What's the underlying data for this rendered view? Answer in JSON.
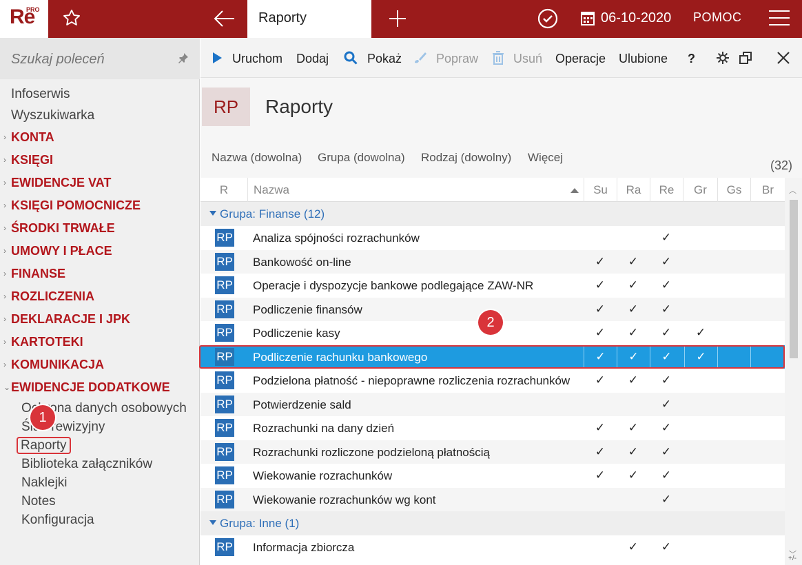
{
  "topbar": {
    "logo_text": "Re",
    "logo_badge": "PRO",
    "active_tab": "Raporty",
    "date": "06-10-2020",
    "help": "POMOC",
    "icons": [
      "star-icon",
      "back-arrow-icon",
      "plus-icon",
      "check-circle-icon",
      "calendar-icon",
      "hamburger-menu-icon"
    ]
  },
  "sidebar": {
    "search_placeholder": "Szukaj poleceń",
    "plain_items": [
      "Infoserwis",
      "Wyszukiwarka"
    ],
    "sections": [
      "KONTA",
      "KSIĘGI",
      "EWIDENCJE VAT",
      "KSIĘGI POMOCNICZE",
      "ŚRODKI TRWAŁE",
      "UMOWY I PŁACE",
      "FINANSE",
      "ROZLICZENIA",
      "DEKLARACJE I JPK",
      "KARTOTEKI",
      "KOMUNIKACJA",
      "EWIDENCJE DODATKOWE"
    ],
    "sub_items": [
      "Ochrona danych osobowych",
      "Ślad rewizyjny",
      "Raporty",
      "Biblioteka załączników",
      "Naklejki",
      "Notes",
      "Konfiguracja"
    ],
    "selected_sub_item": "Raporty",
    "callout_1": "1"
  },
  "toolbar": {
    "run": "Uruchom",
    "add": "Dodaj",
    "show": "Pokaż",
    "edit": "Popraw",
    "delete": "Usuń",
    "operations": "Operacje",
    "favorites": "Ulubione",
    "help": "?"
  },
  "header": {
    "badge": "RP",
    "title": "Raporty"
  },
  "filters": {
    "name": "Nazwa (dowolna)",
    "group": "Grupa (dowolna)",
    "kind": "Rodzaj (dowolny)",
    "more": "Więcej",
    "count": "(32)"
  },
  "grid": {
    "columns": [
      "R",
      "Nazwa",
      "Su",
      "Ra",
      "Re",
      "Gr",
      "Gs",
      "Br"
    ],
    "groups": [
      {
        "label": "Grupa: ",
        "name": "Finanse",
        "count": "(12)",
        "rows": [
          {
            "icon": "RP",
            "name": "Analiza spójności rozrachunków",
            "su": "",
            "ra": "",
            "re": "✓",
            "gr": "",
            "gs": "",
            "br": ""
          },
          {
            "icon": "RP",
            "name": "Bankowość on-line",
            "su": "✓",
            "ra": "✓",
            "re": "✓",
            "gr": "",
            "gs": "",
            "br": ""
          },
          {
            "icon": "RP",
            "name": "Operacje i dyspozycje bankowe podlegające ZAW-NR",
            "su": "✓",
            "ra": "✓",
            "re": "✓",
            "gr": "",
            "gs": "",
            "br": ""
          },
          {
            "icon": "RP",
            "name": "Podliczenie finansów",
            "su": "✓",
            "ra": "✓",
            "re": "✓",
            "gr": "",
            "gs": "",
            "br": ""
          },
          {
            "icon": "RP",
            "name": "Podliczenie kasy",
            "su": "✓",
            "ra": "✓",
            "re": "✓",
            "gr": "✓",
            "gs": "",
            "br": ""
          },
          {
            "icon": "RP",
            "name": "Podliczenie rachunku bankowego",
            "su": "✓",
            "ra": "✓",
            "re": "✓",
            "gr": "✓",
            "gs": "",
            "br": ""
          },
          {
            "icon": "RP",
            "name": "Podzielona płatność - niepoprawne rozliczenia rozrachunków",
            "su": "✓",
            "ra": "✓",
            "re": "✓",
            "gr": "",
            "gs": "",
            "br": ""
          },
          {
            "icon": "RP",
            "name": "Potwierdzenie sald",
            "su": "",
            "ra": "",
            "re": "✓",
            "gr": "",
            "gs": "",
            "br": ""
          },
          {
            "icon": "RP",
            "name": "Rozrachunki na dany dzień",
            "su": "✓",
            "ra": "✓",
            "re": "✓",
            "gr": "",
            "gs": "",
            "br": ""
          },
          {
            "icon": "RP",
            "name": "Rozrachunki rozliczone podzieloną płatnością",
            "su": "✓",
            "ra": "✓",
            "re": "✓",
            "gr": "",
            "gs": "",
            "br": ""
          },
          {
            "icon": "RP",
            "name": "Wiekowanie rozrachunków",
            "su": "✓",
            "ra": "✓",
            "re": "✓",
            "gr": "",
            "gs": "",
            "br": ""
          },
          {
            "icon": "RP",
            "name": "Wiekowanie rozrachunków wg kont",
            "su": "",
            "ra": "",
            "re": "✓",
            "gr": "",
            "gs": "",
            "br": ""
          }
        ]
      },
      {
        "label": "Grupa: ",
        "name": "Inne",
        "count": "(1)",
        "rows": [
          {
            "icon": "RP",
            "name": "Informacja zbiorcza",
            "su": "",
            "ra": "✓",
            "re": "✓",
            "gr": "",
            "gs": "",
            "br": ""
          }
        ]
      }
    ],
    "selected_row": "Podliczenie rachunku bankowego",
    "callout_2": "2",
    "footer_mark": "+/-"
  },
  "colors": {
    "brand": "#9b1b1b",
    "selection": "#1e9be0",
    "callout": "#d9343a",
    "group_text": "#2f6fb8"
  }
}
